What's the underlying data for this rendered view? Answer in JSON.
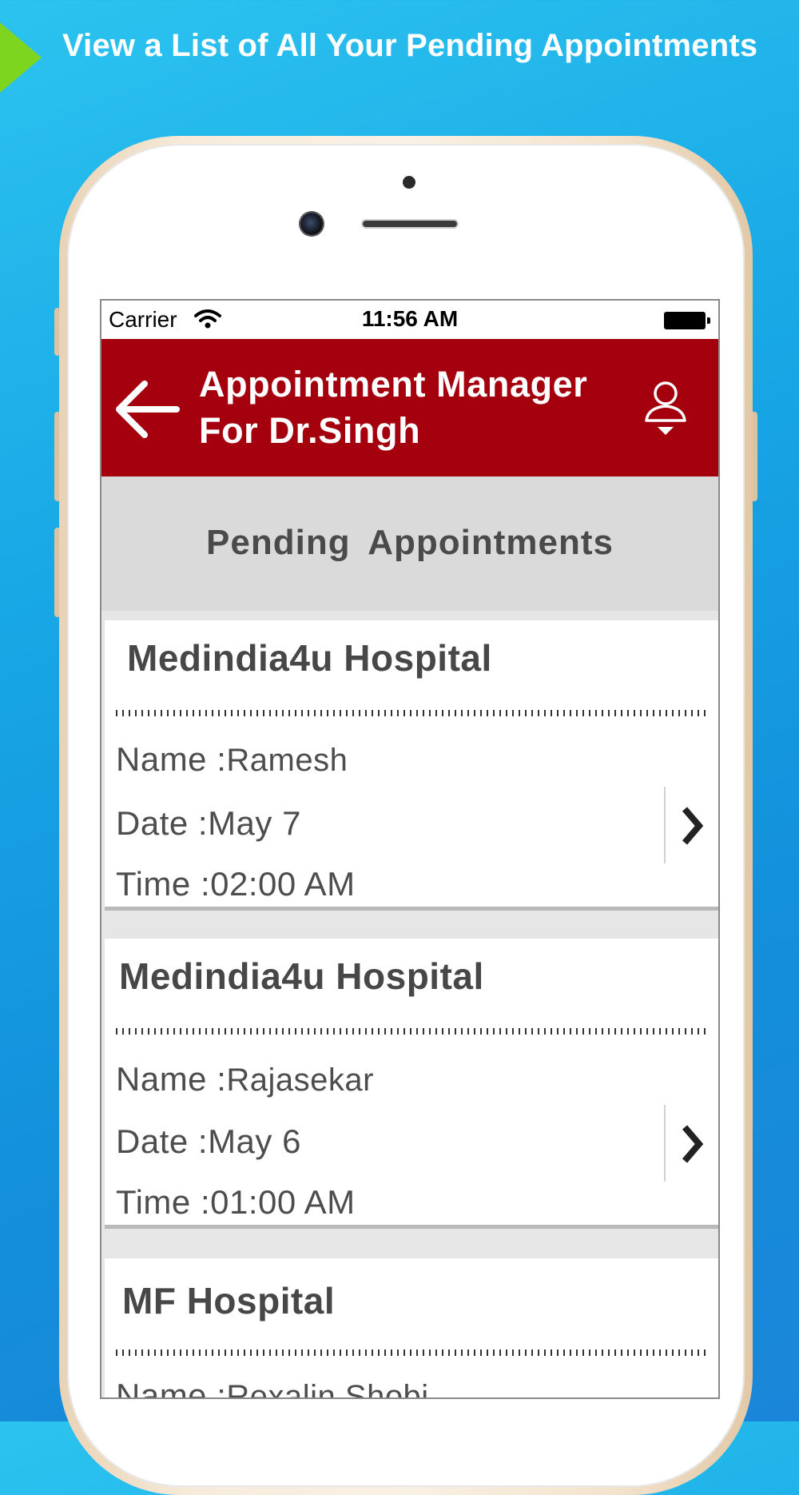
{
  "banner": {
    "text": "View a List of All Your Pending Appointments",
    "arrow_color": "#7dd51f"
  },
  "status_bar": {
    "carrier": "Carrier",
    "time": "11:56 AM"
  },
  "app_bar": {
    "title_line1": "Appointment Manager",
    "title_line2": "For Dr.Singh",
    "color": "#a4000e"
  },
  "section": {
    "title": "Pending  Appointments"
  },
  "labels": {
    "name": "Name :",
    "date": "Date :",
    "time": "Time :"
  },
  "appointments": [
    {
      "hospital": "Medindia4u Hospital",
      "name": "Ramesh",
      "date": "May 7",
      "time": "02:00 AM"
    },
    {
      "hospital": "Medindia4u Hospital",
      "name": "Rajasekar",
      "date": "May 6",
      "time": "01:00 AM"
    },
    {
      "hospital": "MF Hospital",
      "name": "Rexalin Shobi"
    }
  ]
}
